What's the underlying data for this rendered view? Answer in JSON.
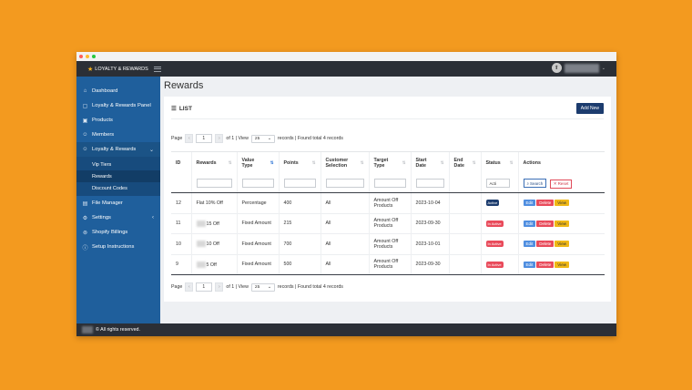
{
  "app": {
    "brand": "LOYALTY & REWARDS",
    "footer": "© All rights reserved."
  },
  "sidebar": {
    "items": [
      {
        "label": "Dashboard",
        "icon": "home-icon"
      },
      {
        "label": "Loyalty & Rewards Panel",
        "icon": "panel-icon"
      },
      {
        "label": "Products",
        "icon": "box-icon"
      },
      {
        "label": "Members",
        "icon": "users-icon"
      },
      {
        "label": "Loyalty & Rewards",
        "icon": "gift-icon"
      },
      {
        "label": "File Manager",
        "icon": "file-icon"
      },
      {
        "label": "Settings",
        "icon": "gear-icon"
      },
      {
        "label": "Shopify Billings",
        "icon": "billing-icon"
      },
      {
        "label": "Setup Instructions",
        "icon": "info-icon"
      }
    ],
    "sub_items": [
      "Vip Tiers",
      "Rewards",
      "Discount Codes"
    ]
  },
  "page": {
    "title": "Rewards",
    "list_label": "LIST",
    "add_new": "Add New"
  },
  "pager": {
    "page_label": "Page",
    "page_value": "1",
    "of_text": "of 1 | View",
    "view_value": "25",
    "found_text": "records | Found total 4 records"
  },
  "table": {
    "headers": [
      [
        "ID"
      ],
      [
        "Rewards"
      ],
      [
        "Value",
        "Type"
      ],
      [
        "Points"
      ],
      [
        "Customer",
        "Selection"
      ],
      [
        "Target",
        "Type"
      ],
      [
        "Start",
        "Date"
      ],
      [
        "End",
        "Date"
      ],
      [
        "Status"
      ],
      [
        "Actions"
      ]
    ],
    "filter": {
      "status_placeholder": "Acti",
      "search": "Search",
      "reset": "Reset"
    },
    "rows": [
      {
        "id": "12",
        "reward": "Flat 10% Off",
        "value_type": "Percentage",
        "points": "400",
        "customer": "All",
        "target1": "Amount Off",
        "target2": "Products",
        "start": "2023-10-04",
        "end": "",
        "status": "Active"
      },
      {
        "id": "11",
        "reward": "15 Off",
        "value_type": "Fixed Amount",
        "points": "215",
        "customer": "All",
        "target1": "Amount Off",
        "target2": "Products",
        "start": "2023-09-30",
        "end": "",
        "status": "In Active"
      },
      {
        "id": "10",
        "reward": "10 Off",
        "value_type": "Fixed Amount",
        "points": "700",
        "customer": "All",
        "target1": "Amount Off",
        "target2": "Products",
        "start": "2023-10-01",
        "end": "",
        "status": "In Active"
      },
      {
        "id": "9",
        "reward": "5 Off",
        "value_type": "Fixed Amount",
        "points": "500",
        "customer": "All",
        "target1": "Amount Off",
        "target2": "Products",
        "start": "2023-09-30",
        "end": "",
        "status": "In Active"
      }
    ],
    "actions": {
      "edit": "Edit",
      "delete": "Delete",
      "view": "View"
    }
  },
  "colors": {
    "background": "#F39A1F",
    "sidebar": "#1f5f9c",
    "topbar": "#2b2f36",
    "active": "#1c3c6e",
    "inactive": "#e94b5b"
  }
}
